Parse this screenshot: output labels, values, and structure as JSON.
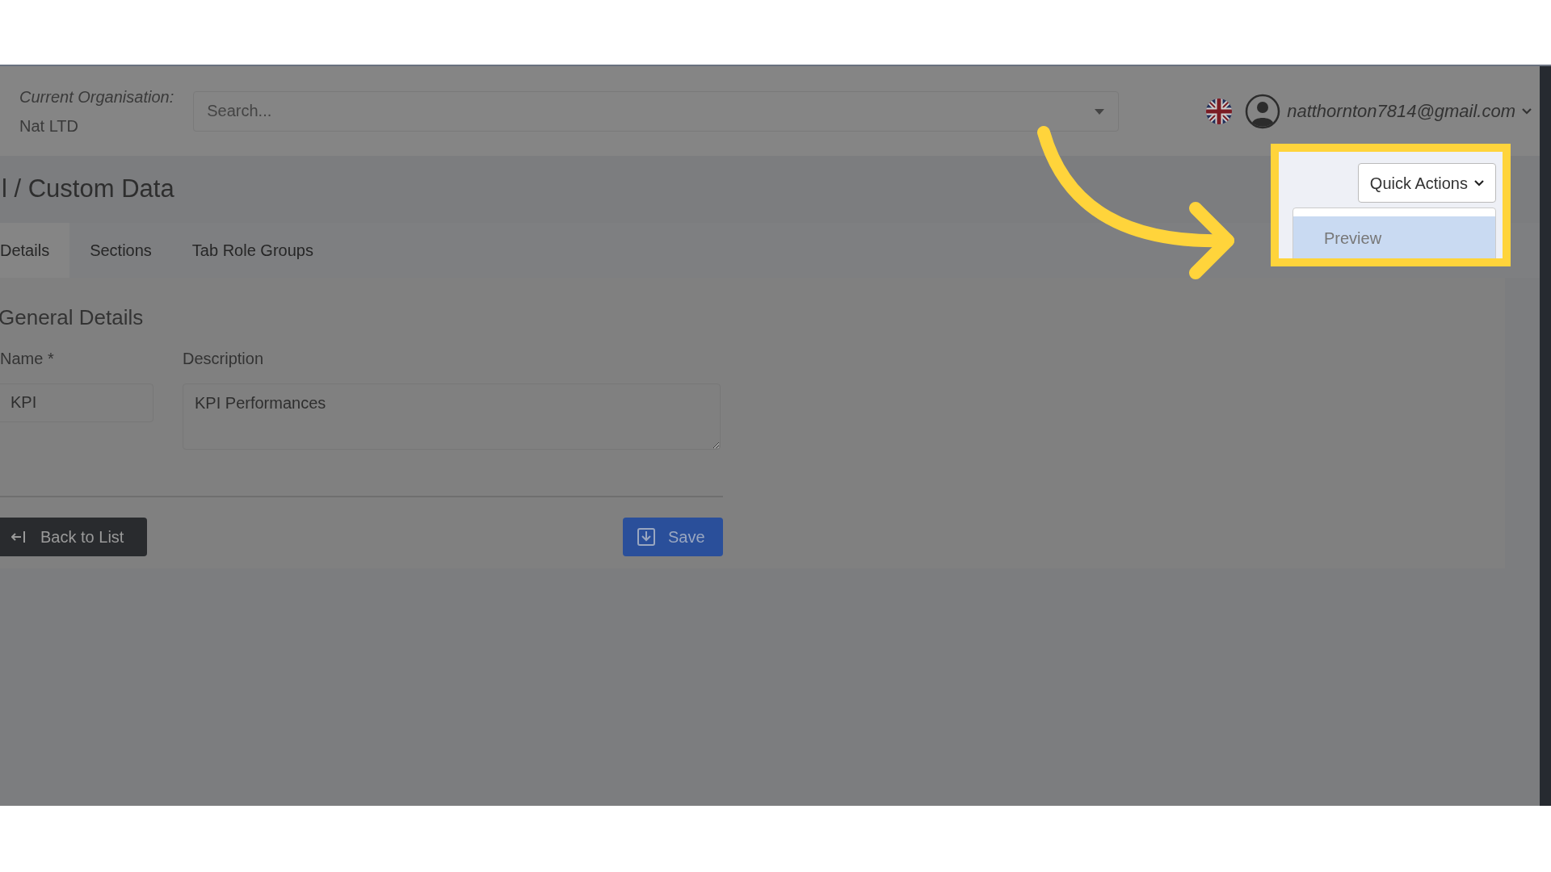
{
  "header": {
    "org_label": "Current Organisation:",
    "org_name": "Nat LTD",
    "search": {
      "placeholder": "Search..."
    },
    "user_email": "natthornton7814@gmail.com"
  },
  "page_title": "l / Custom Data",
  "tabs": [
    {
      "label": "Details",
      "selected": true
    },
    {
      "label": "Sections",
      "selected": false
    },
    {
      "label": "Tab Role Groups",
      "selected": false
    }
  ],
  "section_title": "General Details",
  "fields": [
    {
      "kind": "input",
      "label": "Name *",
      "value": "KPI"
    },
    {
      "kind": "textarea",
      "label": "Description",
      "value": "KPI Performances"
    }
  ],
  "buttons": [
    {
      "kind": "back",
      "label": "Back to List"
    },
    {
      "kind": "save",
      "label": "Save"
    }
  ],
  "quick_actions": {
    "label": "Quick Actions",
    "items": [
      {
        "label": "Preview",
        "selected": true
      }
    ]
  }
}
